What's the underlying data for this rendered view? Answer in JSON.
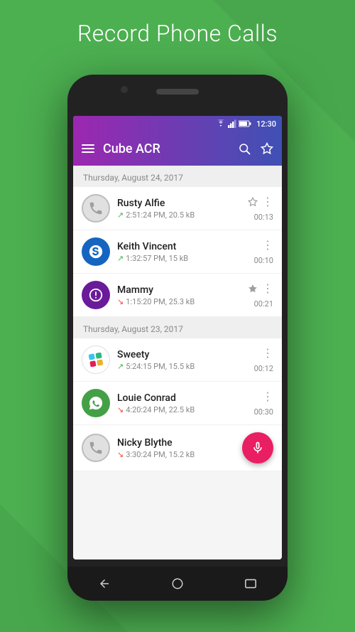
{
  "page": {
    "title": "Record Phone Calls",
    "background_color": "#4caf50"
  },
  "status_bar": {
    "time": "12:30"
  },
  "app_bar": {
    "title": "Cube ACR",
    "search_label": "search",
    "star_label": "favorites"
  },
  "sections": [
    {
      "date": "Thursday, August 24, 2017",
      "calls": [
        {
          "name": "Rusty Alfie",
          "meta_direction": "↗",
          "meta_time": "2:51:24 PM, 20.5 kB",
          "duration": "00:13",
          "starred": false,
          "has_more": true,
          "avatar_type": "phone",
          "avatar_bg": "gray"
        },
        {
          "name": "Keith Vincent",
          "meta_direction": "↗",
          "meta_time": "1:32:57 PM, 15 kB",
          "duration": "00:10",
          "starred": false,
          "has_more": true,
          "avatar_type": "skype",
          "avatar_bg": "blue"
        },
        {
          "name": "Mammy",
          "meta_direction": "↘",
          "meta_time": "1:15:20 PM, 25.3 kB",
          "duration": "00:21",
          "starred": true,
          "has_more": true,
          "avatar_type": "viber",
          "avatar_bg": "purple"
        }
      ]
    },
    {
      "date": "Thursday, August 23, 2017",
      "calls": [
        {
          "name": "Sweety",
          "meta_direction": "↗",
          "meta_time": "5:24:15 PM, 15.5 kB",
          "duration": "00:12",
          "starred": false,
          "has_more": true,
          "avatar_type": "slack",
          "avatar_bg": "slack"
        },
        {
          "name": "Louie Conrad",
          "meta_direction": "↘",
          "meta_time": "4:20:24 PM, 22.5 kB",
          "duration": "00:30",
          "starred": false,
          "has_more": true,
          "avatar_type": "whatsapp",
          "avatar_bg": "green"
        },
        {
          "name": "Nicky Blythe",
          "meta_direction": "↘",
          "meta_time": "3:30:24 PM, 15.2 kB",
          "duration": "",
          "starred": false,
          "has_more": false,
          "avatar_type": "phone",
          "avatar_bg": "gray",
          "has_fab": true
        }
      ]
    }
  ],
  "nav": {
    "back_label": "back",
    "home_label": "home",
    "recents_label": "recents"
  }
}
